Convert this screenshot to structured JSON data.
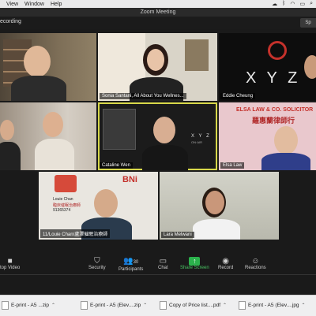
{
  "menubar": {
    "items": [
      "View",
      "Window",
      "Help"
    ]
  },
  "window": {
    "title": "Zoom Meeting"
  },
  "recording": {
    "label": "ecording"
  },
  "view_button": {
    "label": "Sp"
  },
  "participants": [
    {
      "name": ""
    },
    {
      "name": "Sonia Santani, All About You Wellnes..."
    },
    {
      "name": "Eddie Cheung"
    },
    {
      "name": ""
    },
    {
      "name": "Cataline Wen"
    },
    {
      "name": "Elsa Law"
    },
    {
      "name": "11/Louie Chan/盧澤催眠治療師"
    },
    {
      "name": "Lara Melwani"
    }
  ],
  "tile_text": {
    "xyz_logo": "X Y Z",
    "xyz_small": "X Y Z",
    "xyz_small2": "ON·AIR",
    "elsa_sign": "ELSA LAW & CO. SOLICITOR",
    "elsa_chinese": "羅惠蘭律師行",
    "bni": "BNi",
    "louie_card_name": "Louie Chan",
    "louie_card_title": "臨床催眠治療師",
    "louie_card_phone": "91365374"
  },
  "toolbar": {
    "items": [
      {
        "label": "top Video",
        "icon": "video-icon"
      },
      {
        "label": "Security",
        "icon": "shield-icon"
      },
      {
        "label": "Participants",
        "icon": "participants-icon",
        "count": "30"
      },
      {
        "label": "Chat",
        "icon": "chat-icon"
      },
      {
        "label": "Share Screen",
        "icon": "share-icon"
      },
      {
        "label": "Record",
        "icon": "record-icon"
      },
      {
        "label": "Reactions",
        "icon": "reactions-icon"
      }
    ]
  },
  "downloads": [
    {
      "label": "E-print - A5 ...zip"
    },
    {
      "label": "E-print - A5 (Elev....zip"
    },
    {
      "label": "Copy of Price list....pdf"
    },
    {
      "label": "E-print - A5 (Elev....jpg"
    }
  ],
  "colors": {
    "active_outline": "#d8d84a",
    "share_green": "#2bb24c",
    "xyz_red": "#c4312b"
  }
}
